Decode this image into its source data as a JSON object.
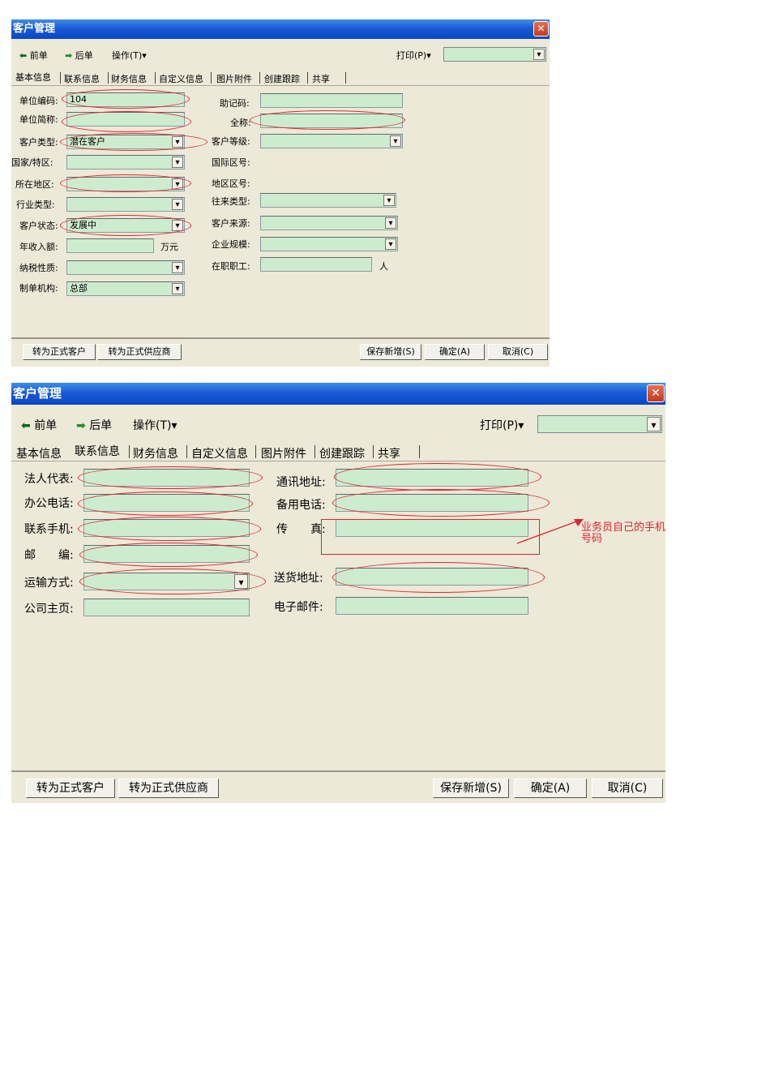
{
  "title": "客户管理",
  "close_glyph": "✕",
  "toolbar": {
    "prev_arrow": "⬅",
    "prev": "前单",
    "next_arrow": "➡",
    "next": "后单",
    "ops": "操作(T)▾",
    "print": "打印(P)▾"
  },
  "tabs": [
    "基本信息",
    "联系信息",
    "财务信息",
    "自定义信息",
    "图片附件",
    "创建跟踪",
    "共享"
  ],
  "dropdown_glyph": "▾",
  "basic": {
    "left": [
      {
        "label": "单位编码:",
        "value": "104"
      },
      {
        "label": "单位简称:",
        "value": ""
      },
      {
        "label": "客户类型:",
        "value": "潜在客户"
      },
      {
        "label": "国家/特区:",
        "value": ""
      },
      {
        "label": "所在地区:",
        "value": ""
      },
      {
        "label": "行业类型:",
        "value": ""
      },
      {
        "label": "客户状态:",
        "value": "发展中"
      },
      {
        "label": "年收入额:",
        "value": "",
        "unit": "万元"
      },
      {
        "label": "纳税性质:",
        "value": ""
      },
      {
        "label": "制单机构:",
        "value": "总部"
      }
    ],
    "right": [
      {
        "label": "助记码:"
      },
      {
        "label": "全称:"
      },
      {
        "label": "客户等级:"
      },
      {
        "label": "国际区号:"
      },
      {
        "label": "地区区号:"
      },
      {
        "label": "往来类型:"
      },
      {
        "label": "客户来源:"
      },
      {
        "label": "企业规模:"
      },
      {
        "label": "在职职工:",
        "unit": "人"
      }
    ]
  },
  "contact": {
    "left": [
      {
        "label": "法人代表:"
      },
      {
        "label": "办公电话:"
      },
      {
        "label": "联系手机:"
      },
      {
        "label": "邮　　编:"
      },
      {
        "label": "运输方式:"
      },
      {
        "label": "公司主页:"
      }
    ],
    "right": [
      {
        "label": "通讯地址:"
      },
      {
        "label": "备用电话:"
      },
      {
        "label": "传　　真:"
      },
      {
        "label": "送货地址:"
      },
      {
        "label": "电子邮件:"
      }
    ],
    "annotation": "业务员自己的手机号码"
  },
  "footer": {
    "to_customer": "转为正式客户",
    "to_supplier": "转为正式供应商",
    "save_new": "保存新增(S)",
    "confirm": "确定(A)",
    "cancel": "取消(C)"
  }
}
